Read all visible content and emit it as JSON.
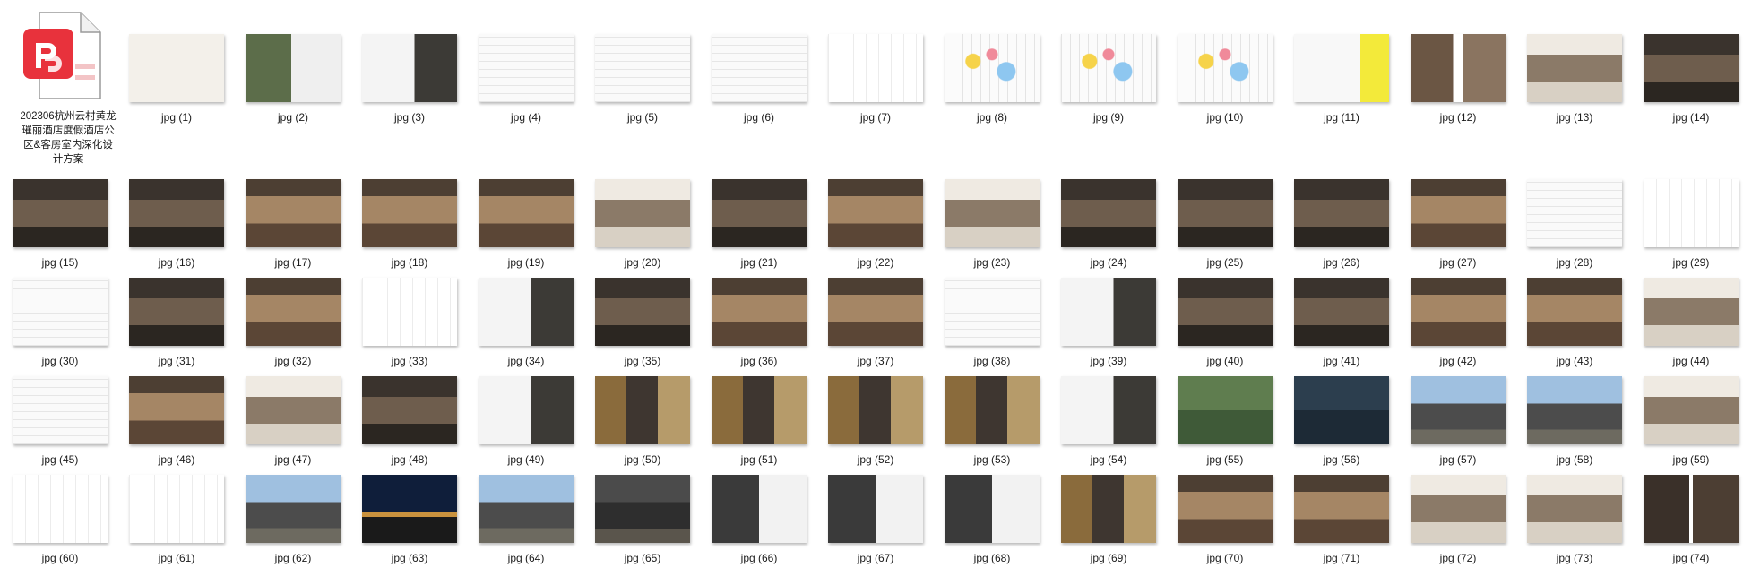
{
  "folder_item": {
    "name_lines": [
      "202306杭州云村黄龙",
      "璀丽酒店度假酒店公",
      "区&客房室内深化设",
      "计方案"
    ],
    "icon": "pdf-document-icon",
    "accent": "#e8323c"
  },
  "thumbnails": [
    {
      "label": "jpg (1)",
      "kind": "cover"
    },
    {
      "label": "jpg (2)",
      "kind": "photo-plan"
    },
    {
      "label": "jpg (3)",
      "kind": "plan-photo"
    },
    {
      "label": "jpg (4)",
      "kind": "plan"
    },
    {
      "label": "jpg (5)",
      "kind": "plan"
    },
    {
      "label": "jpg (6)",
      "kind": "plan"
    },
    {
      "label": "jpg (7)",
      "kind": "plan-light"
    },
    {
      "label": "jpg (8)",
      "kind": "plan-color"
    },
    {
      "label": "jpg (9)",
      "kind": "plan-color"
    },
    {
      "label": "jpg (10)",
      "kind": "plan-color"
    },
    {
      "label": "jpg (11)",
      "kind": "table"
    },
    {
      "label": "jpg (12)",
      "kind": "render-pair"
    },
    {
      "label": "jpg (13)",
      "kind": "render-wide"
    },
    {
      "label": "jpg (14)",
      "kind": "render-dark"
    },
    {
      "label": "jpg (15)",
      "kind": "render-dark"
    },
    {
      "label": "jpg (16)",
      "kind": "render-dark"
    },
    {
      "label": "jpg (17)",
      "kind": "render-warm"
    },
    {
      "label": "jpg (18)",
      "kind": "render-warm"
    },
    {
      "label": "jpg (19)",
      "kind": "render-warm"
    },
    {
      "label": "jpg (20)",
      "kind": "render-wide"
    },
    {
      "label": "jpg (21)",
      "kind": "render-dark"
    },
    {
      "label": "jpg (22)",
      "kind": "render-warm"
    },
    {
      "label": "jpg (23)",
      "kind": "render-wide"
    },
    {
      "label": "jpg (24)",
      "kind": "render-dark"
    },
    {
      "label": "jpg (25)",
      "kind": "render-dark"
    },
    {
      "label": "jpg (26)",
      "kind": "render-dark"
    },
    {
      "label": "jpg (27)",
      "kind": "render-warm"
    },
    {
      "label": "jpg (28)",
      "kind": "plan"
    },
    {
      "label": "jpg (29)",
      "kind": "plan-light"
    },
    {
      "label": "jpg (30)",
      "kind": "plan"
    },
    {
      "label": "jpg (31)",
      "kind": "render-dark"
    },
    {
      "label": "jpg (32)",
      "kind": "render-warm"
    },
    {
      "label": "jpg (33)",
      "kind": "plan-light"
    },
    {
      "label": "jpg (34)",
      "kind": "plan-photo"
    },
    {
      "label": "jpg (35)",
      "kind": "render-dark"
    },
    {
      "label": "jpg (36)",
      "kind": "render-warm"
    },
    {
      "label": "jpg (37)",
      "kind": "render-warm"
    },
    {
      "label": "jpg (38)",
      "kind": "plan"
    },
    {
      "label": "jpg (39)",
      "kind": "plan-photo"
    },
    {
      "label": "jpg (40)",
      "kind": "render-dark"
    },
    {
      "label": "jpg (41)",
      "kind": "render-dark"
    },
    {
      "label": "jpg (42)",
      "kind": "render-warm"
    },
    {
      "label": "jpg (43)",
      "kind": "render-warm"
    },
    {
      "label": "jpg (44)",
      "kind": "render-wide"
    },
    {
      "label": "jpg (45)",
      "kind": "plan"
    },
    {
      "label": "jpg (46)",
      "kind": "render-warm"
    },
    {
      "label": "jpg (47)",
      "kind": "render-wide"
    },
    {
      "label": "jpg (48)",
      "kind": "render-dark"
    },
    {
      "label": "jpg (49)",
      "kind": "plan-photo"
    },
    {
      "label": "jpg (50)",
      "kind": "moodboard"
    },
    {
      "label": "jpg (51)",
      "kind": "moodboard"
    },
    {
      "label": "jpg (52)",
      "kind": "moodboard"
    },
    {
      "label": "jpg (53)",
      "kind": "moodboard"
    },
    {
      "label": "jpg (54)",
      "kind": "plan-photo"
    },
    {
      "label": "jpg (55)",
      "kind": "aerial"
    },
    {
      "label": "jpg (56)",
      "kind": "aerial-dark"
    },
    {
      "label": "jpg (57)",
      "kind": "exterior"
    },
    {
      "label": "jpg (58)",
      "kind": "exterior"
    },
    {
      "label": "jpg (59)",
      "kind": "render-wide"
    },
    {
      "label": "jpg (60)",
      "kind": "plan-light"
    },
    {
      "label": "jpg (61)",
      "kind": "plan-light"
    },
    {
      "label": "jpg (62)",
      "kind": "exterior"
    },
    {
      "label": "jpg (63)",
      "kind": "night"
    },
    {
      "label": "jpg (64)",
      "kind": "exterior"
    },
    {
      "label": "jpg (65)",
      "kind": "exterior-dark"
    },
    {
      "label": "jpg (66)",
      "kind": "bw"
    },
    {
      "label": "jpg (67)",
      "kind": "bw"
    },
    {
      "label": "jpg (68)",
      "kind": "bw"
    },
    {
      "label": "jpg (69)",
      "kind": "moodboard"
    },
    {
      "label": "jpg (70)",
      "kind": "render-warm"
    },
    {
      "label": "jpg (71)",
      "kind": "render-warm"
    },
    {
      "label": "jpg (72)",
      "kind": "render-wide"
    },
    {
      "label": "jpg (73)",
      "kind": "render-wide"
    },
    {
      "label": "jpg (74)",
      "kind": "render-grid"
    }
  ]
}
